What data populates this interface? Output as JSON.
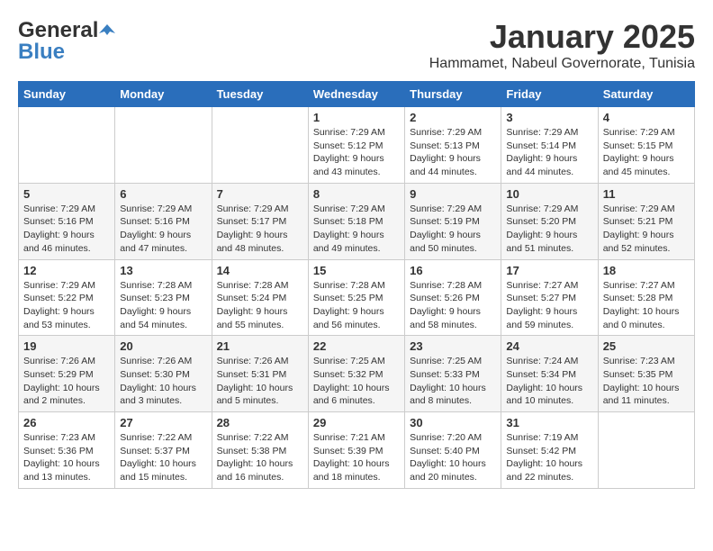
{
  "header": {
    "logo_general": "General",
    "logo_blue": "Blue",
    "month_title": "January 2025",
    "subtitle": "Hammamet, Nabeul Governorate, Tunisia"
  },
  "weekdays": [
    "Sunday",
    "Monday",
    "Tuesday",
    "Wednesday",
    "Thursday",
    "Friday",
    "Saturday"
  ],
  "weeks": [
    [
      {
        "day": "",
        "info": ""
      },
      {
        "day": "",
        "info": ""
      },
      {
        "day": "",
        "info": ""
      },
      {
        "day": "1",
        "info": "Sunrise: 7:29 AM\nSunset: 5:12 PM\nDaylight: 9 hours\nand 43 minutes."
      },
      {
        "day": "2",
        "info": "Sunrise: 7:29 AM\nSunset: 5:13 PM\nDaylight: 9 hours\nand 44 minutes."
      },
      {
        "day": "3",
        "info": "Sunrise: 7:29 AM\nSunset: 5:14 PM\nDaylight: 9 hours\nand 44 minutes."
      },
      {
        "day": "4",
        "info": "Sunrise: 7:29 AM\nSunset: 5:15 PM\nDaylight: 9 hours\nand 45 minutes."
      }
    ],
    [
      {
        "day": "5",
        "info": "Sunrise: 7:29 AM\nSunset: 5:16 PM\nDaylight: 9 hours\nand 46 minutes."
      },
      {
        "day": "6",
        "info": "Sunrise: 7:29 AM\nSunset: 5:16 PM\nDaylight: 9 hours\nand 47 minutes."
      },
      {
        "day": "7",
        "info": "Sunrise: 7:29 AM\nSunset: 5:17 PM\nDaylight: 9 hours\nand 48 minutes."
      },
      {
        "day": "8",
        "info": "Sunrise: 7:29 AM\nSunset: 5:18 PM\nDaylight: 9 hours\nand 49 minutes."
      },
      {
        "day": "9",
        "info": "Sunrise: 7:29 AM\nSunset: 5:19 PM\nDaylight: 9 hours\nand 50 minutes."
      },
      {
        "day": "10",
        "info": "Sunrise: 7:29 AM\nSunset: 5:20 PM\nDaylight: 9 hours\nand 51 minutes."
      },
      {
        "day": "11",
        "info": "Sunrise: 7:29 AM\nSunset: 5:21 PM\nDaylight: 9 hours\nand 52 minutes."
      }
    ],
    [
      {
        "day": "12",
        "info": "Sunrise: 7:29 AM\nSunset: 5:22 PM\nDaylight: 9 hours\nand 53 minutes."
      },
      {
        "day": "13",
        "info": "Sunrise: 7:28 AM\nSunset: 5:23 PM\nDaylight: 9 hours\nand 54 minutes."
      },
      {
        "day": "14",
        "info": "Sunrise: 7:28 AM\nSunset: 5:24 PM\nDaylight: 9 hours\nand 55 minutes."
      },
      {
        "day": "15",
        "info": "Sunrise: 7:28 AM\nSunset: 5:25 PM\nDaylight: 9 hours\nand 56 minutes."
      },
      {
        "day": "16",
        "info": "Sunrise: 7:28 AM\nSunset: 5:26 PM\nDaylight: 9 hours\nand 58 minutes."
      },
      {
        "day": "17",
        "info": "Sunrise: 7:27 AM\nSunset: 5:27 PM\nDaylight: 9 hours\nand 59 minutes."
      },
      {
        "day": "18",
        "info": "Sunrise: 7:27 AM\nSunset: 5:28 PM\nDaylight: 10 hours\nand 0 minutes."
      }
    ],
    [
      {
        "day": "19",
        "info": "Sunrise: 7:26 AM\nSunset: 5:29 PM\nDaylight: 10 hours\nand 2 minutes."
      },
      {
        "day": "20",
        "info": "Sunrise: 7:26 AM\nSunset: 5:30 PM\nDaylight: 10 hours\nand 3 minutes."
      },
      {
        "day": "21",
        "info": "Sunrise: 7:26 AM\nSunset: 5:31 PM\nDaylight: 10 hours\nand 5 minutes."
      },
      {
        "day": "22",
        "info": "Sunrise: 7:25 AM\nSunset: 5:32 PM\nDaylight: 10 hours\nand 6 minutes."
      },
      {
        "day": "23",
        "info": "Sunrise: 7:25 AM\nSunset: 5:33 PM\nDaylight: 10 hours\nand 8 minutes."
      },
      {
        "day": "24",
        "info": "Sunrise: 7:24 AM\nSunset: 5:34 PM\nDaylight: 10 hours\nand 10 minutes."
      },
      {
        "day": "25",
        "info": "Sunrise: 7:23 AM\nSunset: 5:35 PM\nDaylight: 10 hours\nand 11 minutes."
      }
    ],
    [
      {
        "day": "26",
        "info": "Sunrise: 7:23 AM\nSunset: 5:36 PM\nDaylight: 10 hours\nand 13 minutes."
      },
      {
        "day": "27",
        "info": "Sunrise: 7:22 AM\nSunset: 5:37 PM\nDaylight: 10 hours\nand 15 minutes."
      },
      {
        "day": "28",
        "info": "Sunrise: 7:22 AM\nSunset: 5:38 PM\nDaylight: 10 hours\nand 16 minutes."
      },
      {
        "day": "29",
        "info": "Sunrise: 7:21 AM\nSunset: 5:39 PM\nDaylight: 10 hours\nand 18 minutes."
      },
      {
        "day": "30",
        "info": "Sunrise: 7:20 AM\nSunset: 5:40 PM\nDaylight: 10 hours\nand 20 minutes."
      },
      {
        "day": "31",
        "info": "Sunrise: 7:19 AM\nSunset: 5:42 PM\nDaylight: 10 hours\nand 22 minutes."
      },
      {
        "day": "",
        "info": ""
      }
    ]
  ]
}
